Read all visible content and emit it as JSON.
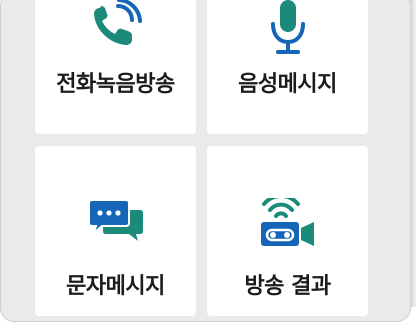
{
  "tiles": [
    {
      "label": "전화녹음방송",
      "icon": "phone-broadcast-icon"
    },
    {
      "label": "음성메시지",
      "icon": "microphone-icon"
    },
    {
      "label": "문자메시지",
      "icon": "chat-bubbles-icon"
    },
    {
      "label": "방송 결과",
      "icon": "broadcast-result-icon"
    }
  ],
  "colors": {
    "icon_green": "#1b8a7a",
    "icon_blue": "#1566b6",
    "background": "#eaeaea",
    "tile": "#ffffff",
    "text": "#1c1c1c"
  }
}
